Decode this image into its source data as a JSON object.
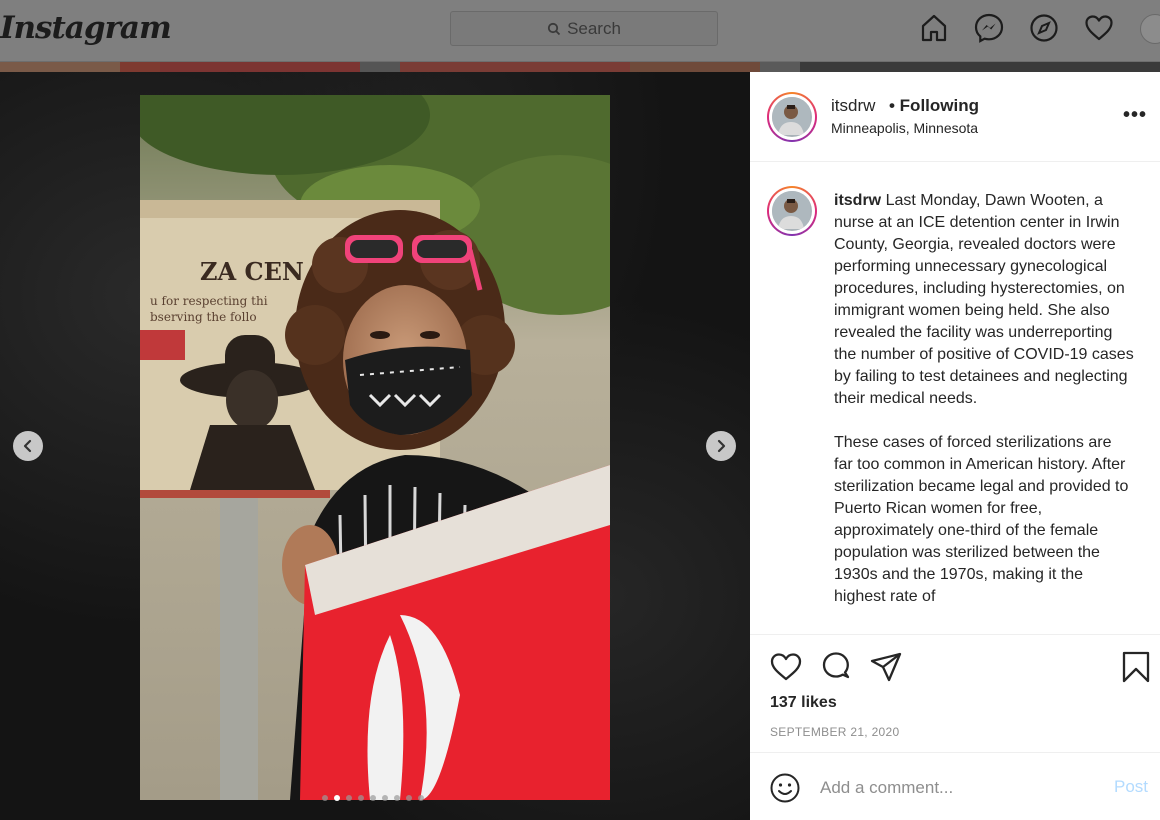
{
  "nav": {
    "logo_text": "Instagram",
    "search_placeholder": "Search",
    "icons": [
      "home-icon",
      "messenger-icon",
      "explore-icon",
      "heart-icon",
      "profile-avatar"
    ]
  },
  "post": {
    "image_alt": "Protester wearing a patterned face mask and pink sunglasses holding a red flag",
    "carousel": {
      "total": 9,
      "active": 2
    },
    "prev_arrow": "‹",
    "next_arrow": "›"
  },
  "header": {
    "username": "itsdrw",
    "follow_status": "• Following",
    "location": "Minneapolis, Minnesota",
    "more": "•••"
  },
  "caption": {
    "username": "itsdrw",
    "text": " Last Monday, Dawn Wooten, a nurse at an ICE detention center in Irwin County, Georgia, revealed doctors were performing unnecessary gynecological procedures, including hysterectomies, on immigrant women being held. She also revealed the facility was underreporting the number of positive of COVID-19 cases by failing to test detainees and neglecting their medical needs.\n\nThese cases of forced sterilizations are far too common in American history. After sterilization became legal and provided to Puerto Rican women for free, approximately one-third of the female population was sterilized between the 1930s and the 1970s, making it the highest rate of"
  },
  "actions": {
    "likes": "137 likes",
    "date": "SEPTEMBER 21, 2020"
  },
  "comment": {
    "placeholder": "Add a comment...",
    "post_label": "Post"
  },
  "colors": {
    "post_disabled": "#b3dbff",
    "text": "#262626",
    "muted": "#8e8e8e",
    "flag_red": "#e8222e",
    "sunglasses_pink": "#f0437a"
  }
}
